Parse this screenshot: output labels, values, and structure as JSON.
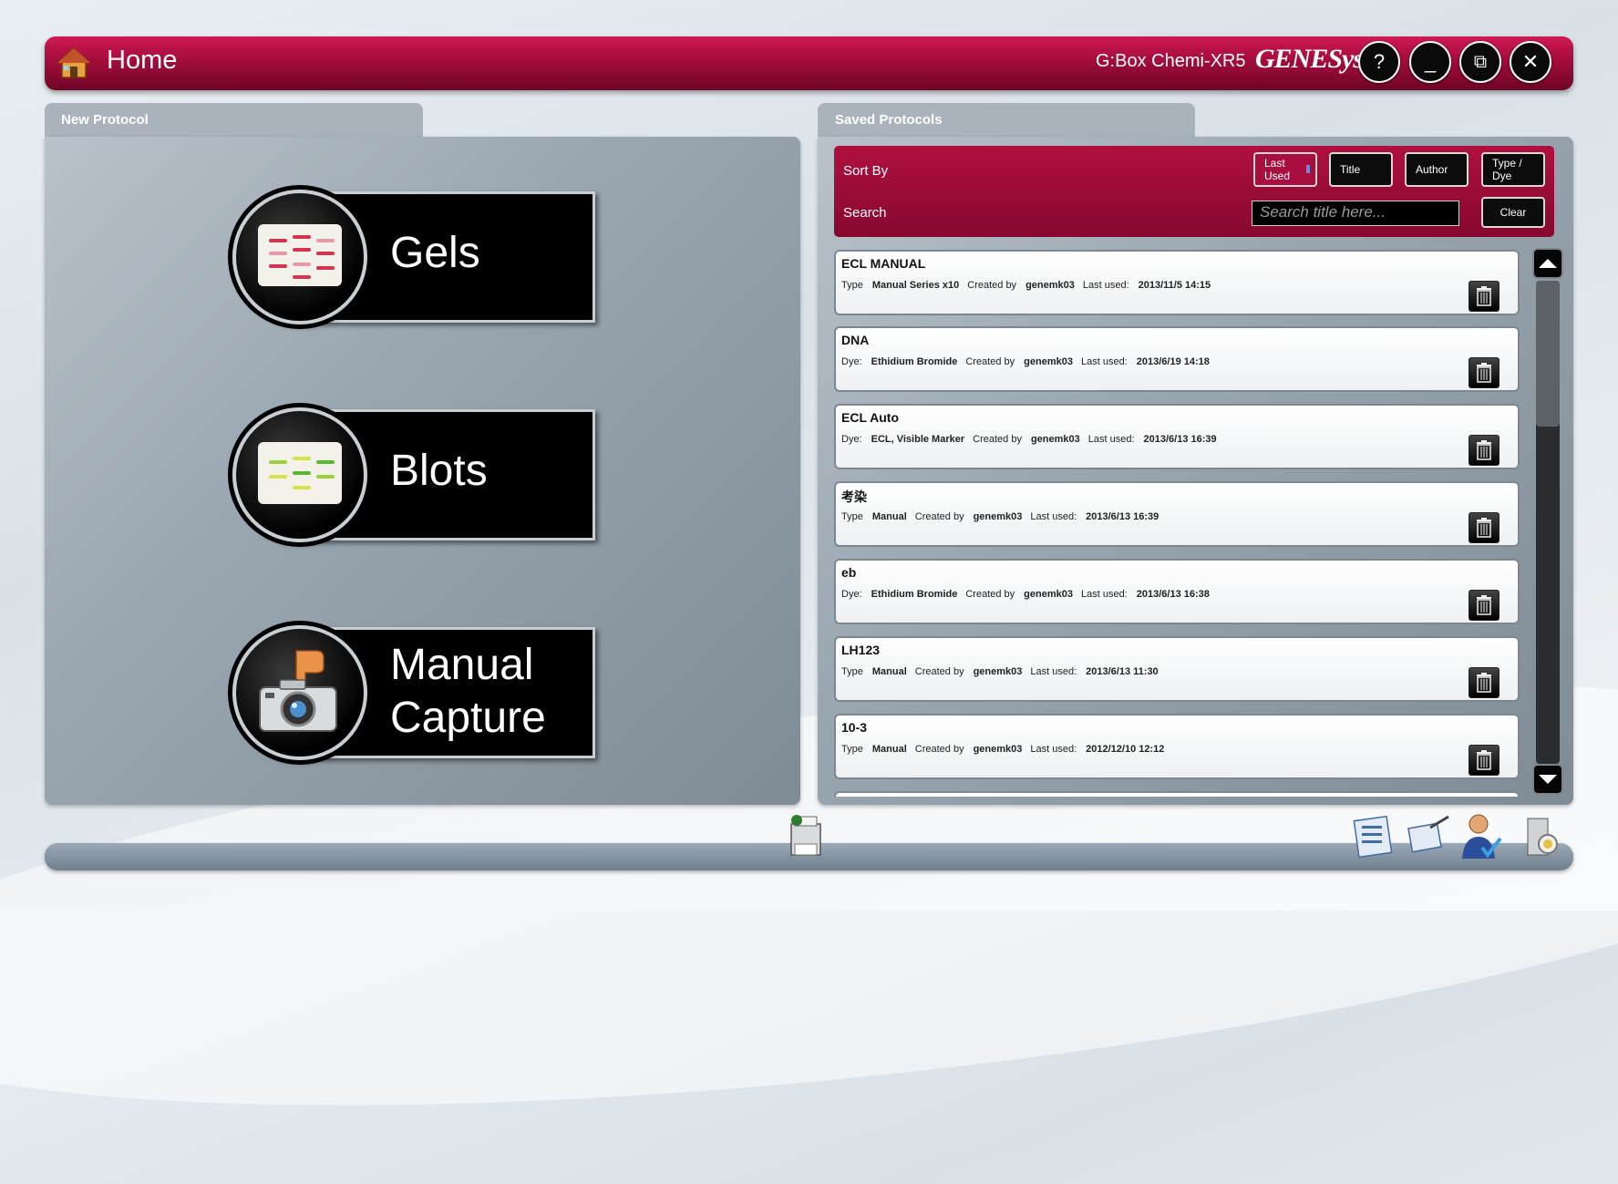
{
  "titlebar": {
    "title": "Home",
    "device": "G:Box Chemi-XR5",
    "brand": "GENESys",
    "help_label": "?",
    "minimize_label": "_",
    "restore_label": "⧉",
    "close_label": "✕"
  },
  "new_protocol": {
    "tab_label": "New Protocol",
    "gels_label": "Gels",
    "blots_label": "Blots",
    "manual_line1": "Manual",
    "manual_line2": "Capture"
  },
  "saved_protocols": {
    "tab_label": "Saved Protocols",
    "sort_by_label": "Sort By",
    "search_label": "Search",
    "search_placeholder": "Search title here...",
    "clear_label": "Clear",
    "sort_buttons": [
      {
        "line1": "Last",
        "line2": "Used",
        "active": true
      },
      {
        "line1": "Title",
        "line2": "",
        "active": false
      },
      {
        "line1": "Author",
        "line2": "",
        "active": false
      },
      {
        "line1": "Type /",
        "line2": "Dye",
        "active": false
      }
    ],
    "items": [
      {
        "title": "ECL MANUAL",
        "kind_label": "Type",
        "kind_value": "Manual Series x10",
        "created_label": "Created by",
        "author": "genemk03",
        "last_used_label": "Last used:",
        "last_used": "2013/11/5 14:15"
      },
      {
        "title": "DNA",
        "kind_label": "Dye:",
        "kind_value": "Ethidium Bromide",
        "created_label": "Created by",
        "author": "genemk03",
        "last_used_label": "Last used:",
        "last_used": "2013/6/19 14:18"
      },
      {
        "title": "ECL Auto",
        "kind_label": "Dye:",
        "kind_value": "ECL, Visible Marker",
        "created_label": "Created by",
        "author": "genemk03",
        "last_used_label": "Last used:",
        "last_used": "2013/6/13 16:39"
      },
      {
        "title": "考染",
        "kind_label": "Type",
        "kind_value": "Manual",
        "created_label": "Created by",
        "author": "genemk03",
        "last_used_label": "Last used:",
        "last_used": "2013/6/13 16:39"
      },
      {
        "title": "eb",
        "kind_label": "Dye:",
        "kind_value": "Ethidium Bromide",
        "created_label": "Created by",
        "author": "genemk03",
        "last_used_label": "Last used:",
        "last_used": "2013/6/13 16:38"
      },
      {
        "title": "LH123",
        "kind_label": "Type",
        "kind_value": "Manual",
        "created_label": "Created by",
        "author": "genemk03",
        "last_used_label": "Last used:",
        "last_used": "2013/6/13 11:30"
      },
      {
        "title": "10-3",
        "kind_label": "Type",
        "kind_value": "Manual",
        "created_label": "Created by",
        "author": "genemk03",
        "last_used_label": "Last used:",
        "last_used": "2012/12/10 12:12"
      }
    ]
  },
  "bottom_icons": [
    "printer-icon",
    "reports-icon",
    "tools-icon",
    "user-icon",
    "settings-icon"
  ],
  "colors": {
    "accent": "#a30c3c",
    "panel": "#9aa6b0"
  }
}
